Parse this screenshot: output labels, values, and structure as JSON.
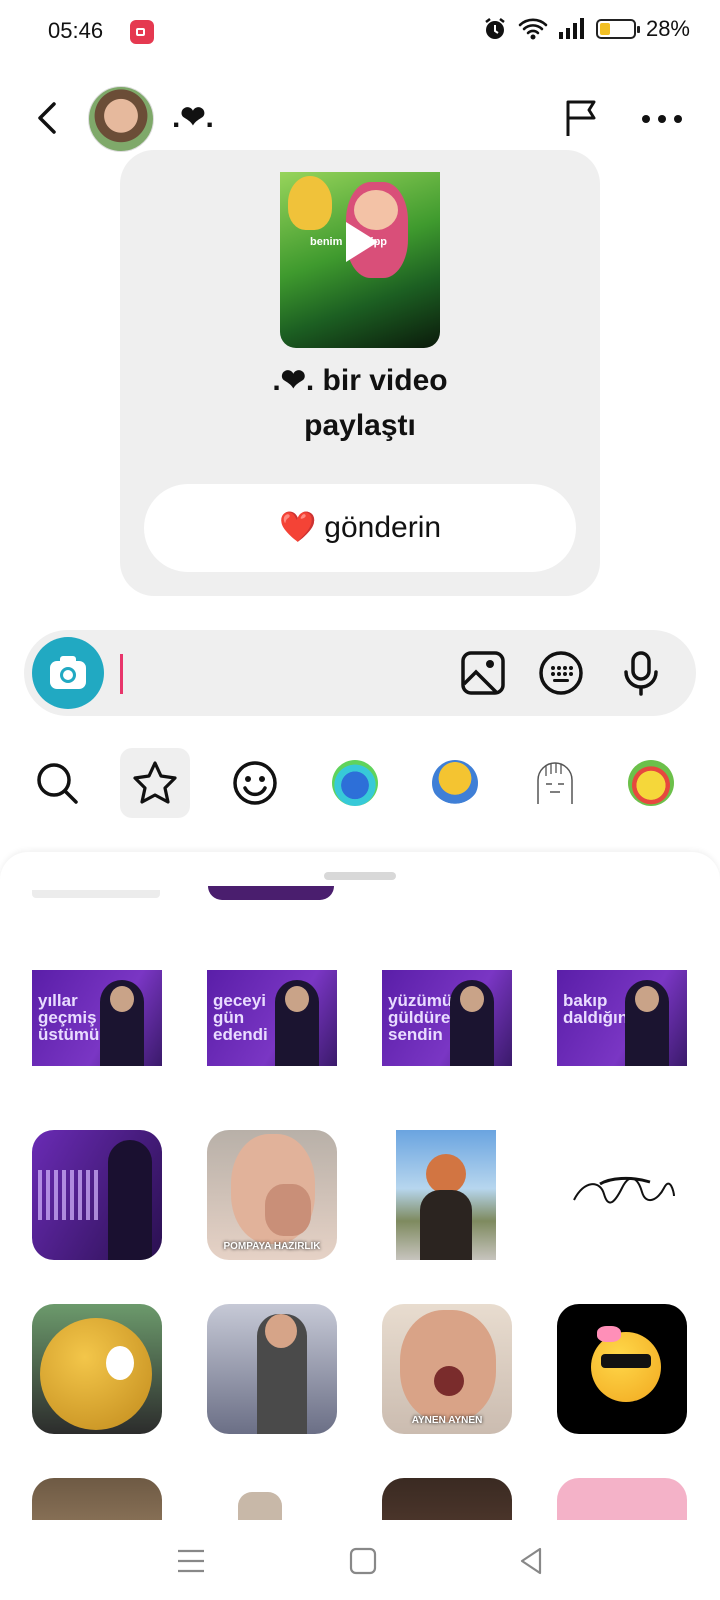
{
  "status_bar": {
    "time": "05:46",
    "battery_text": "28%",
    "battery_level": 0.28,
    "icons": [
      "screen-record-icon",
      "alarm-icon",
      "wifi-icon",
      "signal-icon",
      "battery-icon"
    ]
  },
  "header": {
    "contact_name": ".❤.",
    "icons": [
      "back-arrow-icon",
      "flag-icon",
      "more-icon"
    ]
  },
  "shared_post": {
    "video_caption": "benim ... shipp",
    "text": ".❤. bir video paylaştı",
    "button_emoji": "❤️",
    "button_label": "gönderin"
  },
  "composer": {
    "placeholder": "",
    "value": ""
  },
  "sticker_tabs": [
    "search",
    "favorites",
    "emoji",
    "sticker-pack-1",
    "sticker-pack-2",
    "sticker-pack-3",
    "sticker-pack-4"
  ],
  "stickers": {
    "row1": [
      "yıllar geçmiş üstümü",
      "geceyi gün edendi",
      "yüzümü güldüren sendin",
      "bakıp daldığın"
    ],
    "row2_labels": [
      "POMPAYA HAZIRLIK"
    ],
    "row3_labels": [
      "AYNEN AYNEN"
    ]
  },
  "colors": {
    "camera": "#21a9c2",
    "cursor": "#e8356b",
    "card_bg": "#efefef",
    "heart": "#e0202e"
  }
}
